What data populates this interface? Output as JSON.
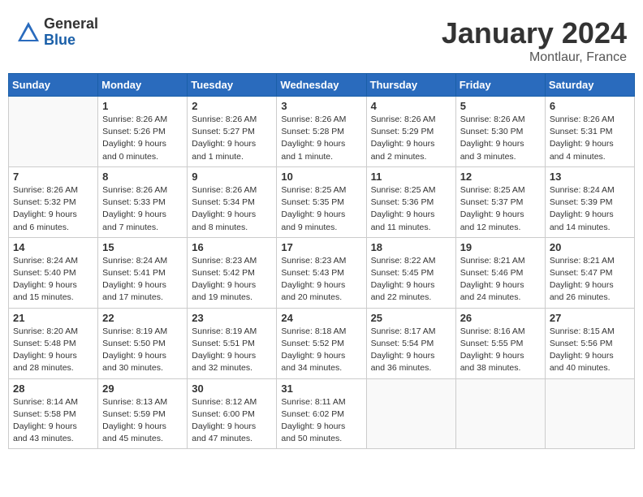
{
  "header": {
    "logo_general": "General",
    "logo_blue": "Blue",
    "month_title": "January 2024",
    "location": "Montlaur, France"
  },
  "days_of_week": [
    "Sunday",
    "Monday",
    "Tuesday",
    "Wednesday",
    "Thursday",
    "Friday",
    "Saturday"
  ],
  "weeks": [
    [
      {
        "day": "",
        "info": ""
      },
      {
        "day": "1",
        "info": "Sunrise: 8:26 AM\nSunset: 5:26 PM\nDaylight: 9 hours\nand 0 minutes."
      },
      {
        "day": "2",
        "info": "Sunrise: 8:26 AM\nSunset: 5:27 PM\nDaylight: 9 hours\nand 1 minute."
      },
      {
        "day": "3",
        "info": "Sunrise: 8:26 AM\nSunset: 5:28 PM\nDaylight: 9 hours\nand 1 minute."
      },
      {
        "day": "4",
        "info": "Sunrise: 8:26 AM\nSunset: 5:29 PM\nDaylight: 9 hours\nand 2 minutes."
      },
      {
        "day": "5",
        "info": "Sunrise: 8:26 AM\nSunset: 5:30 PM\nDaylight: 9 hours\nand 3 minutes."
      },
      {
        "day": "6",
        "info": "Sunrise: 8:26 AM\nSunset: 5:31 PM\nDaylight: 9 hours\nand 4 minutes."
      }
    ],
    [
      {
        "day": "7",
        "info": "Sunrise: 8:26 AM\nSunset: 5:32 PM\nDaylight: 9 hours\nand 6 minutes."
      },
      {
        "day": "8",
        "info": "Sunrise: 8:26 AM\nSunset: 5:33 PM\nDaylight: 9 hours\nand 7 minutes."
      },
      {
        "day": "9",
        "info": "Sunrise: 8:26 AM\nSunset: 5:34 PM\nDaylight: 9 hours\nand 8 minutes."
      },
      {
        "day": "10",
        "info": "Sunrise: 8:25 AM\nSunset: 5:35 PM\nDaylight: 9 hours\nand 9 minutes."
      },
      {
        "day": "11",
        "info": "Sunrise: 8:25 AM\nSunset: 5:36 PM\nDaylight: 9 hours\nand 11 minutes."
      },
      {
        "day": "12",
        "info": "Sunrise: 8:25 AM\nSunset: 5:37 PM\nDaylight: 9 hours\nand 12 minutes."
      },
      {
        "day": "13",
        "info": "Sunrise: 8:24 AM\nSunset: 5:39 PM\nDaylight: 9 hours\nand 14 minutes."
      }
    ],
    [
      {
        "day": "14",
        "info": "Sunrise: 8:24 AM\nSunset: 5:40 PM\nDaylight: 9 hours\nand 15 minutes."
      },
      {
        "day": "15",
        "info": "Sunrise: 8:24 AM\nSunset: 5:41 PM\nDaylight: 9 hours\nand 17 minutes."
      },
      {
        "day": "16",
        "info": "Sunrise: 8:23 AM\nSunset: 5:42 PM\nDaylight: 9 hours\nand 19 minutes."
      },
      {
        "day": "17",
        "info": "Sunrise: 8:23 AM\nSunset: 5:43 PM\nDaylight: 9 hours\nand 20 minutes."
      },
      {
        "day": "18",
        "info": "Sunrise: 8:22 AM\nSunset: 5:45 PM\nDaylight: 9 hours\nand 22 minutes."
      },
      {
        "day": "19",
        "info": "Sunrise: 8:21 AM\nSunset: 5:46 PM\nDaylight: 9 hours\nand 24 minutes."
      },
      {
        "day": "20",
        "info": "Sunrise: 8:21 AM\nSunset: 5:47 PM\nDaylight: 9 hours\nand 26 minutes."
      }
    ],
    [
      {
        "day": "21",
        "info": "Sunrise: 8:20 AM\nSunset: 5:48 PM\nDaylight: 9 hours\nand 28 minutes."
      },
      {
        "day": "22",
        "info": "Sunrise: 8:19 AM\nSunset: 5:50 PM\nDaylight: 9 hours\nand 30 minutes."
      },
      {
        "day": "23",
        "info": "Sunrise: 8:19 AM\nSunset: 5:51 PM\nDaylight: 9 hours\nand 32 minutes."
      },
      {
        "day": "24",
        "info": "Sunrise: 8:18 AM\nSunset: 5:52 PM\nDaylight: 9 hours\nand 34 minutes."
      },
      {
        "day": "25",
        "info": "Sunrise: 8:17 AM\nSunset: 5:54 PM\nDaylight: 9 hours\nand 36 minutes."
      },
      {
        "day": "26",
        "info": "Sunrise: 8:16 AM\nSunset: 5:55 PM\nDaylight: 9 hours\nand 38 minutes."
      },
      {
        "day": "27",
        "info": "Sunrise: 8:15 AM\nSunset: 5:56 PM\nDaylight: 9 hours\nand 40 minutes."
      }
    ],
    [
      {
        "day": "28",
        "info": "Sunrise: 8:14 AM\nSunset: 5:58 PM\nDaylight: 9 hours\nand 43 minutes."
      },
      {
        "day": "29",
        "info": "Sunrise: 8:13 AM\nSunset: 5:59 PM\nDaylight: 9 hours\nand 45 minutes."
      },
      {
        "day": "30",
        "info": "Sunrise: 8:12 AM\nSunset: 6:00 PM\nDaylight: 9 hours\nand 47 minutes."
      },
      {
        "day": "31",
        "info": "Sunrise: 8:11 AM\nSunset: 6:02 PM\nDaylight: 9 hours\nand 50 minutes."
      },
      {
        "day": "",
        "info": ""
      },
      {
        "day": "",
        "info": ""
      },
      {
        "day": "",
        "info": ""
      }
    ]
  ]
}
